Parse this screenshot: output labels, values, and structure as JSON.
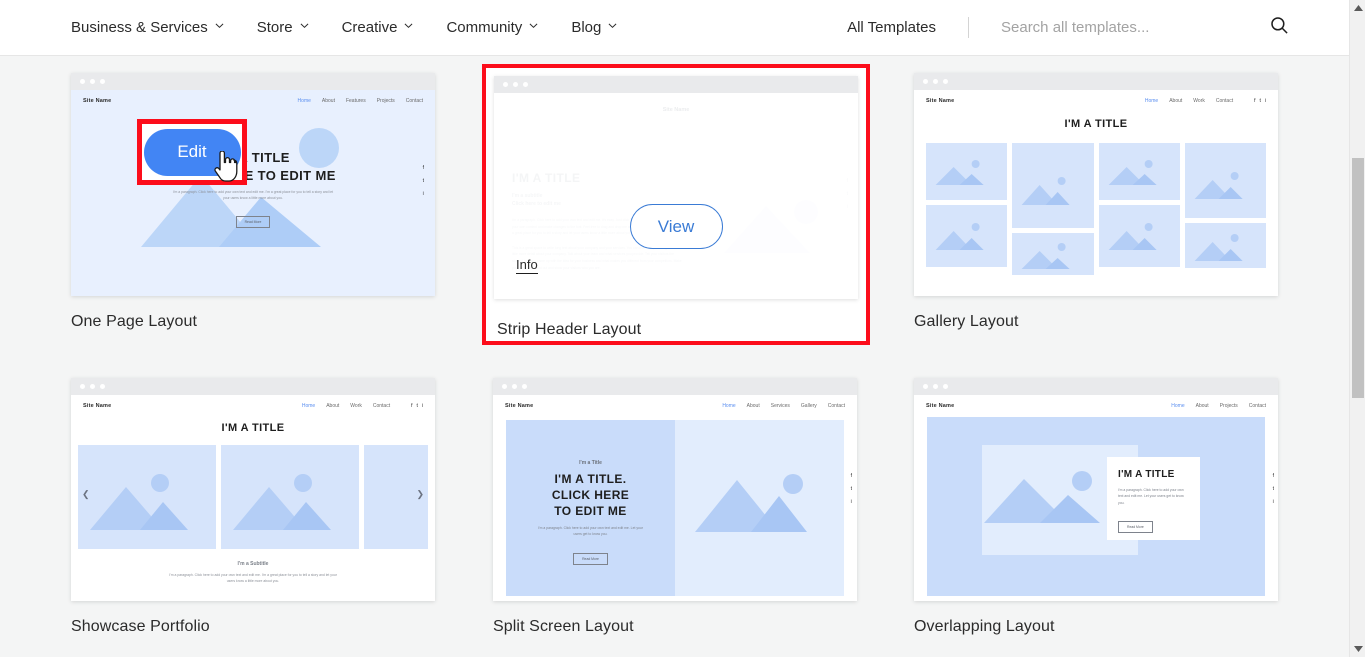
{
  "header": {
    "nav": [
      {
        "label": "Business & Services",
        "icon": "chevron-down-icon"
      },
      {
        "label": "Store",
        "icon": "chevron-down-icon"
      },
      {
        "label": "Creative",
        "icon": "chevron-down-icon"
      },
      {
        "label": "Community",
        "icon": "chevron-down-icon"
      },
      {
        "label": "Blog",
        "icon": "chevron-down-icon"
      }
    ],
    "all_templates": "All Templates",
    "search": {
      "placeholder": "Search all templates...",
      "value": "",
      "icon": "search-icon"
    }
  },
  "colors": {
    "accent_blue": "#4285f4",
    "view_border_blue": "#3a7bd5",
    "highlight_red": "#fc0d1b",
    "page_bg": "#f4f5f5",
    "thumb_light_blue": "#d6e4fb",
    "thumb_panel_blue": "#c9dcfa"
  },
  "overlay": {
    "edit_label": "Edit",
    "view_label": "View",
    "info_label": "Info",
    "cursor": "pointer-hand-cursor"
  },
  "cards": [
    {
      "label": "One Page Layout",
      "site_name": "Site Name",
      "nav": [
        "Home",
        "About",
        "Features",
        "Projects",
        "Contact"
      ],
      "title_line1": "I'M A TITLE",
      "title_line2": "CLICK HERE TO EDIT ME",
      "paragraph": "I'm a paragraph. Click here to add your own text and edit me. I'm a great place for you to tell a story and let your users know a little more about you.",
      "button": "Read More",
      "social": [
        "f",
        "t",
        "i"
      ]
    },
    {
      "label": "Strip Header Layout",
      "site_name": "Site Name",
      "title_line1": "I'M A TITLE",
      "subtitle_line1": "I'm a subtitle",
      "subtitle_line2": "Click here to edit me",
      "paragraph": "I'm a paragraph. Click here to add your own text and edit me. It's easy. Just click Edit Text or double click me to add your own content and make changes to the font. Feel free to drag and drop me anywhere you like on your page. I'm a great place for you to tell a story and let your users know a little more about you.",
      "paragraph2": "This is a great space to write long text about your company and your services. You can use this space to go into a little more detail about your company. Talk about your team and what services you provide. Tell your visitors the story of how you came up with the idea for your business and what makes you different from your competitors. Make your company stand out and show your visitors who you are."
    },
    {
      "label": "Gallery Layout",
      "site_name": "Site Name",
      "nav": [
        "Home",
        "About",
        "Work",
        "Contact"
      ],
      "title_line1": "I'M A TITLE",
      "social": [
        "f",
        "t",
        "i"
      ]
    },
    {
      "label": "Showcase Portfolio",
      "site_name": "Site Name",
      "nav": [
        "Home",
        "About",
        "Work",
        "Contact"
      ],
      "title_line1": "I'M A TITLE",
      "subtitle": "I'm a Subtitle",
      "paragraph": "I'm a paragraph. Click here to add your own text and edit me. I'm a great place for you to tell a story and let your users know a little more about you.",
      "prev_icon": "chevron-left-icon",
      "next_icon": "chevron-right-icon",
      "social": [
        "f",
        "t",
        "i"
      ]
    },
    {
      "label": "Split Screen Layout",
      "site_name": "Site Name",
      "nav": [
        "Home",
        "About",
        "Services",
        "Gallery",
        "Contact"
      ],
      "eyebrow": "I'm a Title",
      "title_line1": "I'M A TITLE.",
      "title_line2": "CLICK HERE",
      "title_line3": "TO EDIT ME",
      "paragraph": "I'm a paragraph. Click here to add your own text and edit me. Let your users get to know you.",
      "button": "Read More",
      "social": [
        "f",
        "t",
        "i"
      ]
    },
    {
      "label": "Overlapping Layout",
      "site_name": "Site Name",
      "nav": [
        "Home",
        "About",
        "Projects",
        "Contact"
      ],
      "title_line1": "I'M A TITLE",
      "paragraph": "I'm a paragraph. Click here to add your own text and edit me. Let your users get to know you.",
      "button": "Read More",
      "social": [
        "f",
        "t",
        "i"
      ]
    }
  ],
  "scrollbar": {
    "up_icon": "scroll-up-arrow-icon",
    "down_icon": "scroll-down-arrow-icon",
    "thumb": "scrollbar-thumb"
  }
}
